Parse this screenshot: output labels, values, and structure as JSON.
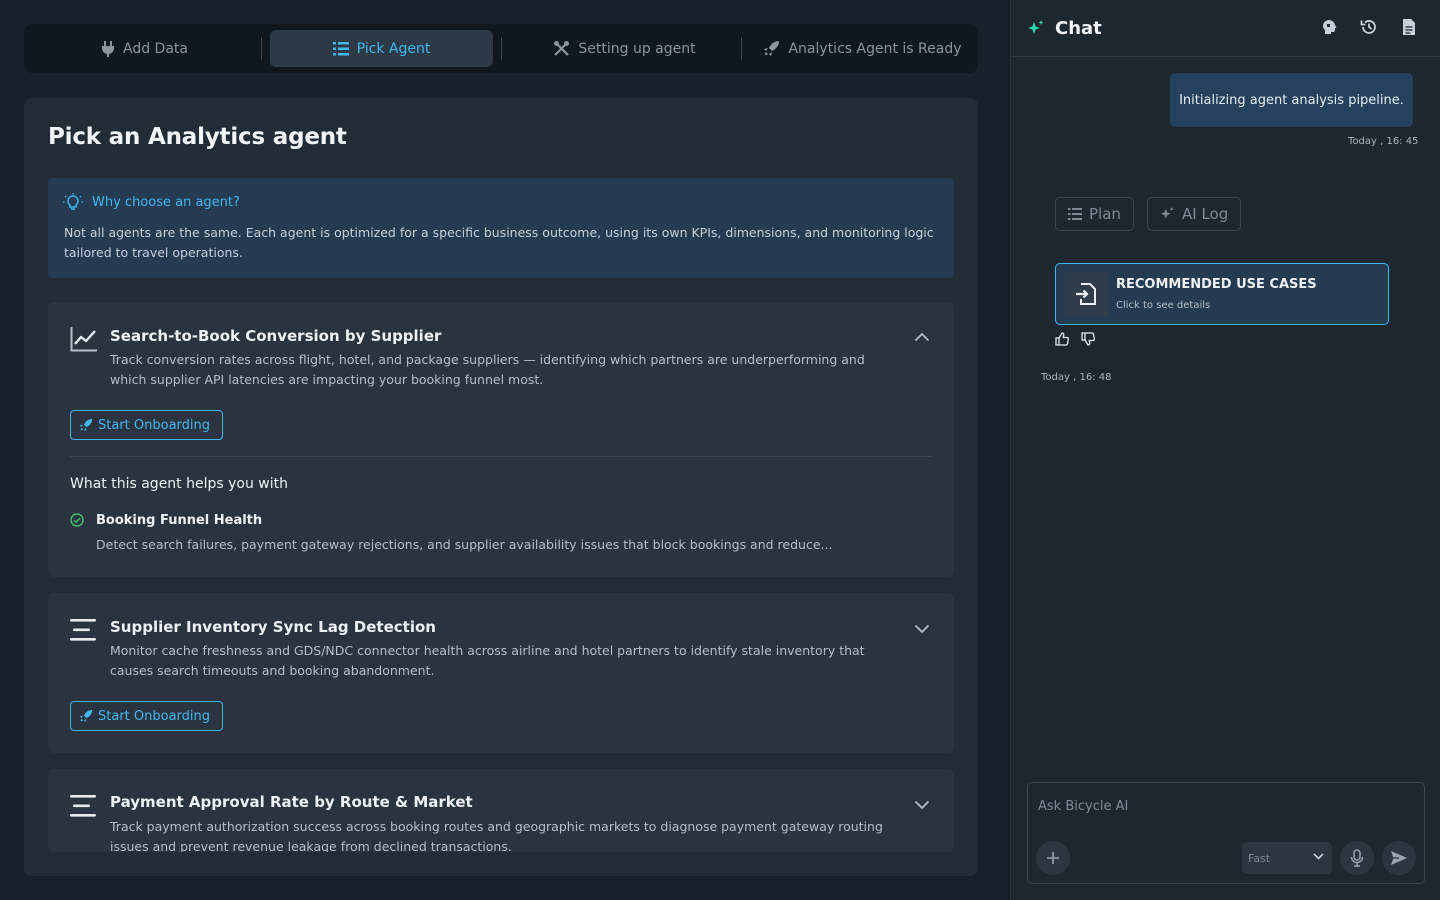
{
  "stepper": {
    "steps": [
      {
        "label": "Add Data",
        "icon": "plug-icon",
        "active": false
      },
      {
        "label": "Pick Agent",
        "icon": "list-icon",
        "active": true
      },
      {
        "label": "Setting up agent",
        "icon": "tools-icon",
        "active": false
      },
      {
        "label": "Analytics Agent is Ready",
        "icon": "rocket-icon",
        "active": false
      }
    ]
  },
  "main": {
    "title": "Pick an Analytics agent",
    "why": {
      "heading": "Why choose an agent?",
      "body": "Not all agents are the same. Each agent is optimized for a specific business outcome, using its own KPIs, dimensions, and monitoring logic tailored to travel operations."
    },
    "agents": [
      {
        "title": "Search-to-Book Conversion by Supplier",
        "description": "Track conversion rates across flight, hotel, and package suppliers — identifying which partners are underperforming and which supplier API latencies are impacting your booking funnel most.",
        "button": "Start Onboarding",
        "helps_title": "What this agent helps you with",
        "helps": [
          {
            "name": "Booking Funnel Health",
            "description": "Detect search failures, payment gateway rejections, and supplier availability issues that block bookings and reduce..."
          }
        ]
      },
      {
        "title": "Supplier Inventory Sync Lag Detection",
        "description": "Monitor cache freshness and GDS/NDC connector health across airline and hotel partners to identify stale inventory that causes search timeouts and booking abandonment.",
        "button": "Start Onboarding"
      },
      {
        "title": "Payment Approval Rate by Route & Market",
        "description": "Track payment authorization success across booking routes and geographic markets to diagnose payment gateway routing issues and prevent revenue leakage from declined transactions."
      }
    ]
  },
  "chat": {
    "title": "Chat",
    "message": "Initializing agent analysis pipeline.",
    "message_time": "Today , 16: 45",
    "plan_label": "Plan",
    "ailog_label": "AI Log",
    "recommended": {
      "title": "RECOMMENDED USE CASES",
      "subtitle": "Click to see details"
    },
    "reply_time": "Today , 16: 48",
    "input_placeholder": "Ask Bicycle AI",
    "mode_label": "Fast"
  },
  "colors": {
    "accent": "#3fb8f0",
    "success": "#3ec46d",
    "panel": "#212c36",
    "card": "#2a3440",
    "info_bg": "#243b52"
  }
}
